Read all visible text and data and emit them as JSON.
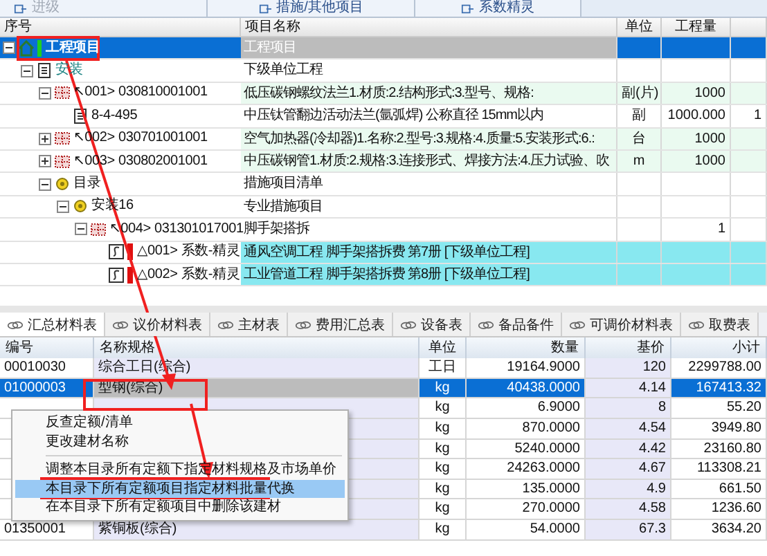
{
  "toolbar": [
    {
      "label": "进级",
      "disabled": true
    },
    {
      "label": "措施/其他项目",
      "disabled": false
    },
    {
      "label": "系数精灵",
      "disabled": false
    }
  ],
  "tree": {
    "columns": [
      "序号",
      "项目名称",
      "单位",
      "工程量"
    ],
    "nodes": [
      {
        "kind": "root",
        "code": "工程项目",
        "name": "工程项目",
        "selected": true,
        "expanded": true,
        "children": [
          {
            "kind": "unit",
            "code": "安装",
            "name": "下级单位工程",
            "selected": false,
            "expanded": true,
            "children": [
              {
                "kind": "bill",
                "code": "↖001> 030810001001",
                "name": "低压碳钢螺纹法兰1.材质:2.结构形式:3.型号、规格:",
                "unit": "副(片)",
                "qty": "1000",
                "selected": false,
                "expanded": true,
                "children": [
                  {
                    "kind": "quota",
                    "code": "8-4-495",
                    "name": "中压钛管翻边活动法兰(氩弧焊) 公称直径 15mm以内",
                    "unit": "副",
                    "qty": "1000.000",
                    "extra": "1",
                    "selected": false
                  }
                ]
              },
              {
                "kind": "bill",
                "code": "↖002> 030701001001",
                "name": "空气加热器(冷却器)1.名称:2.型号:3.规格:4.质量:5.安装形式:6.:",
                "unit": "台",
                "qty": "1000",
                "selected": false,
                "expanded": false
              },
              {
                "kind": "bill",
                "code": "↖003> 030802001001",
                "name": "中压碳钢管1.材质:2.规格:3.连接形式、焊接方法:4.压力试验、吹",
                "unit": "m",
                "qty": "1000",
                "selected": false,
                "expanded": false
              },
              {
                "kind": "catalog",
                "code": "目录",
                "name": "措施项目清单",
                "selected": false,
                "expanded": true,
                "children": [
                  {
                    "kind": "catalog",
                    "code": "安装16",
                    "name": "专业措施项目",
                    "selected": false,
                    "expanded": true,
                    "children": [
                      {
                        "kind": "measure",
                        "code": "↖004> 031301017001",
                        "name": "脚手架搭拆",
                        "qty": "1",
                        "selected": false,
                        "expanded": true,
                        "children": [
                          {
                            "kind": "coef",
                            "code": "△001> 系数-精灵",
                            "name": "通风空调工程 脚手架搭拆费 第7册 [下级单位工程]",
                            "selected": false
                          },
                          {
                            "kind": "coef",
                            "code": "△002> 系数-精灵",
                            "name": "工业管道工程 脚手架搭拆费 第8册 [下级单位工程]",
                            "selected": false
                          }
                        ]
                      }
                    ]
                  }
                ]
              }
            ]
          }
        ]
      }
    ]
  },
  "tabs": [
    {
      "label": "汇总材料表",
      "selected": true
    },
    {
      "label": "议价材料表",
      "selected": false
    },
    {
      "label": "主材表",
      "selected": false
    },
    {
      "label": "费用汇总表",
      "selected": false
    },
    {
      "label": "设备表",
      "selected": false
    },
    {
      "label": "备品备件",
      "selected": false
    },
    {
      "label": "可调价材料表",
      "selected": false
    },
    {
      "label": "取费表",
      "selected": false
    }
  ],
  "materials": {
    "columns": [
      "编号",
      "名称规格",
      "单位",
      "数量",
      "基价",
      "小计"
    ],
    "rows": [
      {
        "code": "00010030",
        "name": "综合工日(综合)",
        "unit": "工日",
        "qty": "19164.9000",
        "price": "120",
        "total": "2299788.00",
        "selected": false
      },
      {
        "code": "01000003",
        "name": "型钢(综合)",
        "unit": "kg",
        "qty": "40438.0000",
        "price": "4.14",
        "total": "167413.32",
        "selected": true
      },
      {
        "unit": "kg",
        "qty": "6.9000",
        "price": "8",
        "total": "55.20",
        "selected": false
      },
      {
        "unit": "kg",
        "qty": "870.0000",
        "price": "4.54",
        "total": "3949.80",
        "selected": false
      },
      {
        "unit": "kg",
        "qty": "5240.0000",
        "price": "4.42",
        "total": "23160.80",
        "selected": false
      },
      {
        "unit": "kg",
        "qty": "24263.0000",
        "price": "4.67",
        "total": "113308.21",
        "selected": false
      },
      {
        "unit": "kg",
        "qty": "135.0000",
        "price": "4.9",
        "total": "661.50",
        "selected": false
      },
      {
        "unit": "kg",
        "qty": "270.0000",
        "price": "4.58",
        "total": "1236.60",
        "selected": false
      },
      {
        "code": "01350001",
        "name": "紫铜板(综合)",
        "unit": "kg",
        "qty": "54.0000",
        "price": "67.3",
        "total": "3634.20",
        "selected": false
      }
    ]
  },
  "context_menu": [
    {
      "kind": "item",
      "label": "反查定额/清单",
      "selected": false
    },
    {
      "kind": "item",
      "label": "更改建材名称",
      "selected": false
    },
    {
      "kind": "separator"
    },
    {
      "kind": "item",
      "label": "调整本目录所有定额下指定材料规格及市场单价",
      "selected": false
    },
    {
      "kind": "item",
      "label": "本目录下所有定额项目指定材料批量代换",
      "selected": true
    },
    {
      "kind": "item",
      "label": "在本目录下所有定额项目中删除该建材",
      "selected": false
    }
  ]
}
